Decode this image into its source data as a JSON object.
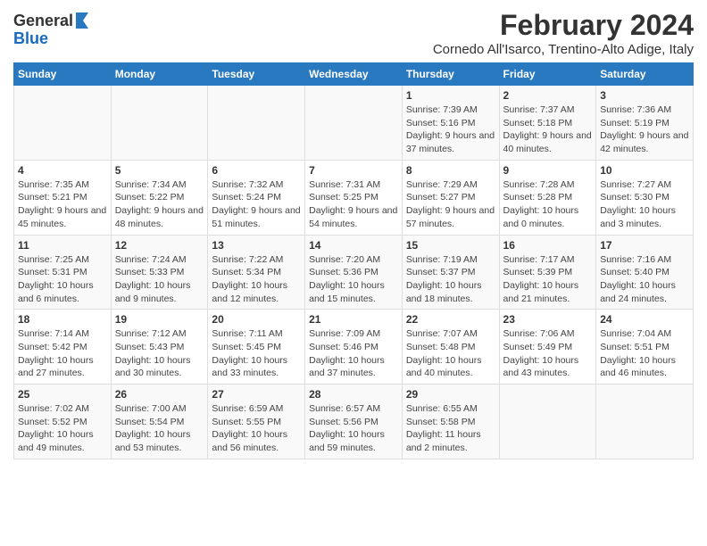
{
  "logo": {
    "general": "General",
    "blue": "Blue"
  },
  "title": "February 2024",
  "subtitle": "Cornedo All'Isarco, Trentino-Alto Adige, Italy",
  "weekdays": [
    "Sunday",
    "Monday",
    "Tuesday",
    "Wednesday",
    "Thursday",
    "Friday",
    "Saturday"
  ],
  "weeks": [
    [
      {
        "day": "",
        "info": ""
      },
      {
        "day": "",
        "info": ""
      },
      {
        "day": "",
        "info": ""
      },
      {
        "day": "",
        "info": ""
      },
      {
        "day": "1",
        "info": "Sunrise: 7:39 AM\nSunset: 5:16 PM\nDaylight: 9 hours and 37 minutes."
      },
      {
        "day": "2",
        "info": "Sunrise: 7:37 AM\nSunset: 5:18 PM\nDaylight: 9 hours and 40 minutes."
      },
      {
        "day": "3",
        "info": "Sunrise: 7:36 AM\nSunset: 5:19 PM\nDaylight: 9 hours and 42 minutes."
      }
    ],
    [
      {
        "day": "4",
        "info": "Sunrise: 7:35 AM\nSunset: 5:21 PM\nDaylight: 9 hours and 45 minutes."
      },
      {
        "day": "5",
        "info": "Sunrise: 7:34 AM\nSunset: 5:22 PM\nDaylight: 9 hours and 48 minutes."
      },
      {
        "day": "6",
        "info": "Sunrise: 7:32 AM\nSunset: 5:24 PM\nDaylight: 9 hours and 51 minutes."
      },
      {
        "day": "7",
        "info": "Sunrise: 7:31 AM\nSunset: 5:25 PM\nDaylight: 9 hours and 54 minutes."
      },
      {
        "day": "8",
        "info": "Sunrise: 7:29 AM\nSunset: 5:27 PM\nDaylight: 9 hours and 57 minutes."
      },
      {
        "day": "9",
        "info": "Sunrise: 7:28 AM\nSunset: 5:28 PM\nDaylight: 10 hours and 0 minutes."
      },
      {
        "day": "10",
        "info": "Sunrise: 7:27 AM\nSunset: 5:30 PM\nDaylight: 10 hours and 3 minutes."
      }
    ],
    [
      {
        "day": "11",
        "info": "Sunrise: 7:25 AM\nSunset: 5:31 PM\nDaylight: 10 hours and 6 minutes."
      },
      {
        "day": "12",
        "info": "Sunrise: 7:24 AM\nSunset: 5:33 PM\nDaylight: 10 hours and 9 minutes."
      },
      {
        "day": "13",
        "info": "Sunrise: 7:22 AM\nSunset: 5:34 PM\nDaylight: 10 hours and 12 minutes."
      },
      {
        "day": "14",
        "info": "Sunrise: 7:20 AM\nSunset: 5:36 PM\nDaylight: 10 hours and 15 minutes."
      },
      {
        "day": "15",
        "info": "Sunrise: 7:19 AM\nSunset: 5:37 PM\nDaylight: 10 hours and 18 minutes."
      },
      {
        "day": "16",
        "info": "Sunrise: 7:17 AM\nSunset: 5:39 PM\nDaylight: 10 hours and 21 minutes."
      },
      {
        "day": "17",
        "info": "Sunrise: 7:16 AM\nSunset: 5:40 PM\nDaylight: 10 hours and 24 minutes."
      }
    ],
    [
      {
        "day": "18",
        "info": "Sunrise: 7:14 AM\nSunset: 5:42 PM\nDaylight: 10 hours and 27 minutes."
      },
      {
        "day": "19",
        "info": "Sunrise: 7:12 AM\nSunset: 5:43 PM\nDaylight: 10 hours and 30 minutes."
      },
      {
        "day": "20",
        "info": "Sunrise: 7:11 AM\nSunset: 5:45 PM\nDaylight: 10 hours and 33 minutes."
      },
      {
        "day": "21",
        "info": "Sunrise: 7:09 AM\nSunset: 5:46 PM\nDaylight: 10 hours and 37 minutes."
      },
      {
        "day": "22",
        "info": "Sunrise: 7:07 AM\nSunset: 5:48 PM\nDaylight: 10 hours and 40 minutes."
      },
      {
        "day": "23",
        "info": "Sunrise: 7:06 AM\nSunset: 5:49 PM\nDaylight: 10 hours and 43 minutes."
      },
      {
        "day": "24",
        "info": "Sunrise: 7:04 AM\nSunset: 5:51 PM\nDaylight: 10 hours and 46 minutes."
      }
    ],
    [
      {
        "day": "25",
        "info": "Sunrise: 7:02 AM\nSunset: 5:52 PM\nDaylight: 10 hours and 49 minutes."
      },
      {
        "day": "26",
        "info": "Sunrise: 7:00 AM\nSunset: 5:54 PM\nDaylight: 10 hours and 53 minutes."
      },
      {
        "day": "27",
        "info": "Sunrise: 6:59 AM\nSunset: 5:55 PM\nDaylight: 10 hours and 56 minutes."
      },
      {
        "day": "28",
        "info": "Sunrise: 6:57 AM\nSunset: 5:56 PM\nDaylight: 10 hours and 59 minutes."
      },
      {
        "day": "29",
        "info": "Sunrise: 6:55 AM\nSunset: 5:58 PM\nDaylight: 11 hours and 2 minutes."
      },
      {
        "day": "",
        "info": ""
      },
      {
        "day": "",
        "info": ""
      }
    ]
  ]
}
